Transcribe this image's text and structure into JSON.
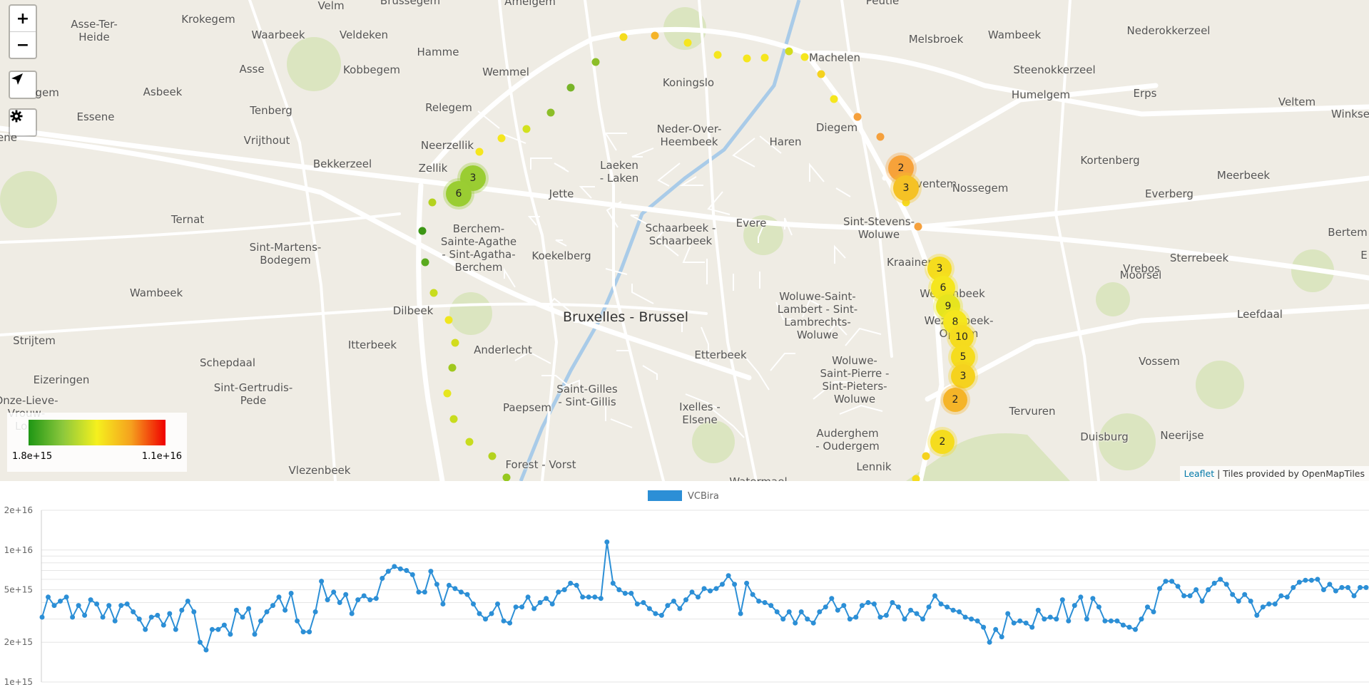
{
  "map": {
    "controls": {
      "zoom_in": "+",
      "zoom_out": "−",
      "locate_icon": "navigation-arrow-icon",
      "settings_icon": "gear-icon"
    },
    "places": [
      {
        "name": "Asse-Ter-\nHeide"
      },
      {
        "name": "Krokegem"
      },
      {
        "name": "Velm"
      },
      {
        "name": "Amelgem"
      },
      {
        "name": "Peutie"
      },
      {
        "name": "Waarbeek"
      },
      {
        "name": "Veldeken"
      },
      {
        "name": "Melsbroek"
      },
      {
        "name": "Wambeek"
      },
      {
        "name": "Nederokkerzeel"
      },
      {
        "name": "Hamme"
      },
      {
        "name": "Machelen"
      },
      {
        "name": "Asse"
      },
      {
        "name": "Kobbegem"
      },
      {
        "name": "Wemmel"
      },
      {
        "name": "Steenokkerzeel"
      },
      {
        "name": "Koningslo"
      },
      {
        "name": "Asbeek"
      },
      {
        "name": "Erps"
      },
      {
        "name": "Humelgem"
      },
      {
        "name": "Veltem"
      },
      {
        "name": "Winkse"
      },
      {
        "name": "Relegem"
      },
      {
        "name": "Tenberg"
      },
      {
        "name": "Essene"
      },
      {
        "name": "Diegem"
      },
      {
        "name": "Neder-Over-\nHeembeek"
      },
      {
        "name": "Vrijthout"
      },
      {
        "name": "Neerzellik"
      },
      {
        "name": "Haren"
      },
      {
        "name": "Kortenberg"
      },
      {
        "name": "Bekkerzeel"
      },
      {
        "name": "Zellik"
      },
      {
        "name": "Laeken\n- Laken"
      },
      {
        "name": "Meerbeek"
      },
      {
        "name": "Zaventem"
      },
      {
        "name": "Nossegem"
      },
      {
        "name": "Everberg"
      },
      {
        "name": "Jette"
      },
      {
        "name": "Ternat"
      },
      {
        "name": "Sint-Stevens-\nWoluwe"
      },
      {
        "name": "Evere"
      },
      {
        "name": "Schaarbeek -\nSchaarbeek"
      },
      {
        "name": "Berchem-\nSainte-Agathe\n- Sint-Agatha-\nBerchem"
      },
      {
        "name": "Sint-Martens-\nBodegem"
      },
      {
        "name": "Koekelberg"
      },
      {
        "name": "Bertem"
      },
      {
        "name": "Sterrebeek"
      },
      {
        "name": "Kraainem"
      },
      {
        "name": "Moorsel"
      },
      {
        "name": "Vrebos"
      },
      {
        "name": "Wambeek"
      },
      {
        "name": "Wezembeek"
      },
      {
        "name": "Woluwe-Saint-\nLambert - Sint-\nLambrechts-\nWoluwe"
      },
      {
        "name": "Dilbeek"
      },
      {
        "name": "Leefdaal"
      },
      {
        "name": "Wezembeek-\nOppem"
      },
      {
        "name": "Strijtem"
      },
      {
        "name": "Itterbeek"
      },
      {
        "name": "Schepdaal"
      },
      {
        "name": "Anderlecht"
      },
      {
        "name": "Etterbeek"
      },
      {
        "name": "Vossem"
      },
      {
        "name": "Eizeringen"
      },
      {
        "name": "Woluwe-\nSaint-Pierre -\nSint-Pieters-\nWoluwe"
      },
      {
        "name": "Sint-Gertrudis-\nPede"
      },
      {
        "name": "Saint-Gilles\n- Sint-Gillis"
      },
      {
        "name": "Onze-Lieve-\nVrouw-\nLom"
      },
      {
        "name": "Tervuren"
      },
      {
        "name": "Paepsem"
      },
      {
        "name": "Ixelles -\nElsene"
      },
      {
        "name": "Auderghem\n- Oudergem"
      },
      {
        "name": "Duisburg"
      },
      {
        "name": "Neerijse"
      },
      {
        "name": "Lennik"
      },
      {
        "name": "Vlezenbeek"
      },
      {
        "name": "Forest - Vorst"
      },
      {
        "name": "Watermael"
      },
      {
        "name": "Brussegem"
      },
      {
        "name": "ligem"
      },
      {
        "name": "ene"
      },
      {
        "name": "E"
      }
    ],
    "city": "Bruxelles - Brussel",
    "clusters": [
      {
        "count": "3",
        "color": "#9acd32"
      },
      {
        "count": "6",
        "color": "#9acd32"
      },
      {
        "count": "2",
        "color": "#f7a23a"
      },
      {
        "count": "3",
        "color": "#f5c225"
      },
      {
        "count": "3",
        "color": "#f5dc1e"
      },
      {
        "count": "6",
        "color": "#f5e61e"
      },
      {
        "count": "9",
        "color": "#e6e41e"
      },
      {
        "count": "8",
        "color": "#f5e61e"
      },
      {
        "count": "10",
        "color": "#f5dc1e"
      },
      {
        "count": "5",
        "color": "#f5dc1e"
      },
      {
        "count": "3",
        "color": "#f5d21e"
      },
      {
        "count": "2",
        "color": "#f5b428"
      },
      {
        "count": "2",
        "color": "#f5dc1e"
      }
    ],
    "dots": [
      {
        "color": "#f5dc1e"
      },
      {
        "color": "#f5b428"
      },
      {
        "color": "#f5e61e"
      },
      {
        "color": "#f5e61e"
      },
      {
        "color": "#f5e61e"
      },
      {
        "color": "#f5e61e"
      },
      {
        "color": "#d2dc1e"
      },
      {
        "color": "#f5e61e"
      },
      {
        "color": "#f5d21e"
      },
      {
        "color": "#f5e61e"
      },
      {
        "color": "#f5a03c"
      },
      {
        "color": "#f5a03c"
      },
      {
        "color": "#8cbe28"
      },
      {
        "color": "#78b428"
      },
      {
        "color": "#8cbe28"
      },
      {
        "color": "#d2e11e"
      },
      {
        "color": "#f5e61e"
      },
      {
        "color": "#f5e61e"
      },
      {
        "color": "#b4d21e"
      },
      {
        "color": "#3c9614"
      },
      {
        "color": "#5aaa1e"
      },
      {
        "color": "#c8dc1e"
      },
      {
        "color": "#f0e61e"
      },
      {
        "color": "#d2dc1e"
      },
      {
        "color": "#a0c81e"
      },
      {
        "color": "#e6e61e"
      },
      {
        "color": "#c8dc1e"
      },
      {
        "color": "#c8dc1e"
      },
      {
        "color": "#b4d21e"
      },
      {
        "color": "#96c81e"
      },
      {
        "color": "#f5a03c"
      },
      {
        "color": "#f5dc1e"
      },
      {
        "color": "#f5d21e"
      },
      {
        "color": "#f5dc1e"
      }
    ],
    "legend": {
      "min_label": "1.8e+15",
      "max_label": "1.1e+16",
      "gradient": [
        "#1e9614",
        "#8cc83c",
        "#f5f01e",
        "#f5a01e",
        "#f00000"
      ]
    },
    "attribution": {
      "link": "Leaflet",
      "text": " | Tiles provided by OpenMapTiles"
    }
  },
  "chart_data": {
    "type": "line",
    "series": [
      {
        "name": "VCBira",
        "color": "#2c8fd6",
        "values": [
          3100000000000000.0,
          4400000000000000.0,
          3800000000000000.0,
          4100000000000000.0,
          4400000000000000.0,
          3100000000000000.0,
          3800000000000000.0,
          3200000000000000.0,
          4200000000000000.0,
          3900000000000000.0,
          3100000000000000.0,
          3800000000000000.0,
          2900000000000000.0,
          3800000000000000.0,
          3900000000000000.0,
          3400000000000000.0,
          3000000000000000.0,
          2500000000000000.0,
          3100000000000000.0,
          3200000000000000.0,
          2700000000000000.0,
          3300000000000000.0,
          2500000000000000.0,
          3500000000000000.0,
          4100000000000000.0,
          3400000000000000.0,
          2000000000000000.0,
          1750000000000000.0,
          2500000000000000.0,
          2500000000000000.0,
          2700000000000000.0,
          2300000000000000.0,
          3500000000000000.0,
          3100000000000000.0,
          3600000000000000.0,
          2300000000000000.0,
          2900000000000000.0,
          3400000000000000.0,
          3800000000000000.0,
          4400000000000000.0,
          3500000000000000.0,
          4700000000000000.0,
          2900000000000000.0,
          2400000000000000.0,
          2400000000000000.0,
          3400000000000000.0,
          5800000000000000.0,
          4200000000000000.0,
          4800000000000000.0,
          4000000000000000.0,
          4600000000000000.0,
          3300000000000000.0,
          4200000000000000.0,
          4500000000000000.0,
          4200000000000000.0,
          4300000000000000.0,
          6100000000000000.0,
          6900000000000000.0,
          7500000000000000.0,
          7200000000000000.0,
          7000000000000000.0,
          6500000000000000.0,
          4800000000000000.0,
          4800000000000000.0,
          6900000000000000.0,
          5500000000000000.0,
          3900000000000000.0,
          5400000000000000.0,
          5100000000000000.0,
          4800000000000000.0,
          4600000000000000.0,
          3900000000000000.0,
          3300000000000000.0,
          3000000000000000.0,
          3300000000000000.0,
          3900000000000000.0,
          2900000000000000.0,
          2800000000000000.0,
          3700000000000000.0,
          3700000000000000.0,
          4400000000000000.0,
          3600000000000000.0,
          4000000000000000.0,
          4300000000000000.0,
          3900000000000000.0,
          4800000000000000.0,
          5000000000000000.0,
          5600000000000000.0,
          5400000000000000.0,
          4400000000000000.0,
          4400000000000000.0,
          4400000000000000.0,
          4300000000000000.0,
          1.15e+16,
          5600000000000000.0,
          5000000000000000.0,
          4700000000000000.0,
          4700000000000000.0,
          3900000000000000.0,
          4000000000000000.0,
          3600000000000000.0,
          3300000000000000.0,
          3200000000000000.0,
          3800000000000000.0,
          4100000000000000.0,
          3600000000000000.0,
          4200000000000000.0,
          4800000000000000.0,
          4400000000000000.0,
          5100000000000000.0,
          4900000000000000.0,
          5100000000000000.0,
          5500000000000000.0,
          6400000000000000.0,
          5500000000000000.0,
          3300000000000000.0,
          5600000000000000.0,
          4600000000000000.0,
          4100000000000000.0,
          4000000000000000.0,
          3800000000000000.0,
          3400000000000000.0,
          3000000000000000.0,
          3400000000000000.0,
          2800000000000000.0,
          3400000000000000.0,
          3000000000000000.0,
          2800000000000000.0,
          3400000000000000.0,
          3700000000000000.0,
          4300000000000000.0,
          3500000000000000.0,
          3800000000000000.0,
          3000000000000000.0,
          3100000000000000.0,
          3800000000000000.0,
          4000000000000000.0,
          3900000000000000.0,
          3100000000000000.0,
          3200000000000000.0,
          4000000000000000.0,
          3700000000000000.0,
          3000000000000000.0,
          3500000000000000.0,
          3300000000000000.0,
          3000000000000000.0,
          3700000000000000.0,
          4500000000000000.0,
          3900000000000000.0,
          3700000000000000.0,
          3500000000000000.0,
          3400000000000000.0,
          3100000000000000.0,
          3000000000000000.0,
          2900000000000000.0,
          2600000000000000.0,
          2000000000000000.0,
          2500000000000000.0,
          2200000000000000.0,
          3300000000000000.0,
          2800000000000000.0,
          2900000000000000.0,
          2800000000000000.0,
          2600000000000000.0,
          3500000000000000.0,
          3000000000000000.0,
          3100000000000000.0,
          3000000000000000.0,
          4200000000000000.0,
          2900000000000000.0,
          3800000000000000.0,
          4400000000000000.0,
          3000000000000000.0,
          4300000000000000.0,
          3700000000000000.0,
          2900000000000000.0,
          2900000000000000.0,
          2900000000000000.0,
          2700000000000000.0,
          2600000000000000.0,
          2500000000000000.0,
          3000000000000000.0,
          3700000000000000.0,
          3400000000000000.0,
          5100000000000000.0,
          5800000000000000.0,
          5800000000000000.0,
          5300000000000000.0,
          4500000000000000.0,
          4500000000000000.0,
          5000000000000000.0,
          4100000000000000.0,
          5000000000000000.0,
          5600000000000000.0,
          6000000000000000.0,
          5500000000000000.0,
          4600000000000000.0,
          4100000000000000.0,
          4600000000000000.0,
          4100000000000000.0,
          3200000000000000.0,
          3700000000000000.0,
          3900000000000000.0,
          3900000000000000.0,
          4500000000000000.0,
          4400000000000000.0,
          5200000000000000.0,
          5700000000000000.0,
          5900000000000000.0,
          5900000000000000.0,
          6000000000000000.0,
          5000000000000000.0,
          5500000000000000.0,
          4900000000000000.0,
          5200000000000000.0,
          5200000000000000.0,
          4500000000000000.0,
          5200000000000000.0,
          5200000000000000.0
        ]
      }
    ],
    "ylabels": [
      "2e+16",
      "1e+16",
      "5e+15",
      "2e+15",
      "1e+15"
    ],
    "yscale": "log",
    "ylim": [
      1000000000000000.0,
      2e+16
    ],
    "grid": true,
    "legend_position": "top-center"
  }
}
